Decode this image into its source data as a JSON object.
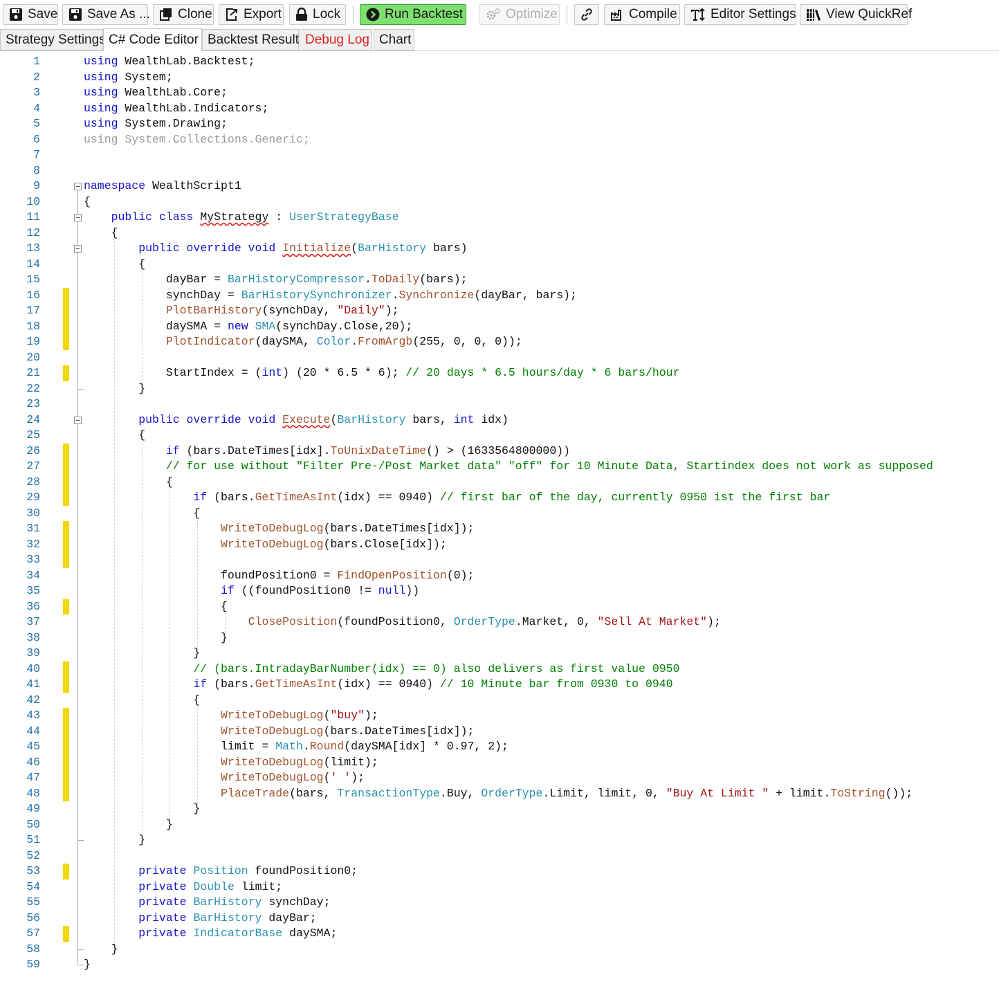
{
  "toolbar": {
    "save": "Save",
    "save_as": "Save As ...",
    "clone": "Clone",
    "export": "Export",
    "lock": "Lock",
    "run_backtest": "Run Backtest",
    "optimize": "Optimize",
    "compile": "Compile",
    "editor_settings": "Editor Settings",
    "view_quickref": "View QuickRef"
  },
  "tabs": [
    "Strategy Settings",
    "C# Code Editor",
    "Backtest Results",
    "Debug Log",
    "Chart"
  ],
  "active_tab": "C# Code Editor",
  "colors": {
    "keyword": "#1414c8",
    "type": "#2b91af",
    "method": "#a0522d",
    "string": "#a31515",
    "comment": "#008000",
    "line_number": "#1e6fa8",
    "change_marker": "#f2d700",
    "run_button": "#7ee06f",
    "debug_tab_text": "#e02020"
  },
  "icons": {
    "save": "floppy-disk-icon",
    "save_as": "floppy-disk-icon",
    "clone": "copy-icon",
    "export": "export-icon",
    "lock": "padlock-icon",
    "run_backtest": "play-circle-icon",
    "optimize": "gears-icon",
    "link": "link-icon",
    "compile": "compile-icon",
    "editor_settings": "text-size-icon",
    "view_quickref": "books-icon"
  },
  "editor": {
    "lines": [
      {
        "n": "1",
        "t": [
          [
            "kw",
            "using"
          ],
          [
            "pl",
            " WealthLab.Backtest;"
          ]
        ]
      },
      {
        "n": "2",
        "t": [
          [
            "kw",
            "using"
          ],
          [
            "pl",
            " System;"
          ]
        ]
      },
      {
        "n": "3",
        "t": [
          [
            "kw",
            "using"
          ],
          [
            "pl",
            " WealthLab.Core;"
          ]
        ]
      },
      {
        "n": "4",
        "t": [
          [
            "kw",
            "using"
          ],
          [
            "pl",
            " WealthLab.Indicators;"
          ]
        ]
      },
      {
        "n": "5",
        "t": [
          [
            "kw",
            "using"
          ],
          [
            "pl",
            " System.Drawing;"
          ]
        ]
      },
      {
        "n": "6",
        "t": [
          [
            "dim",
            "using System.Collections.Generic;"
          ]
        ]
      },
      {
        "n": "7",
        "t": []
      },
      {
        "n": "8",
        "t": []
      },
      {
        "n": "9",
        "t": [
          [
            "kw",
            "namespace"
          ],
          [
            "pl",
            " WealthScript1"
          ]
        ]
      },
      {
        "n": "10",
        "t": [
          [
            "pl",
            "{"
          ]
        ]
      },
      {
        "n": "11",
        "t": [
          [
            "pl",
            "    "
          ],
          [
            "kw",
            "public class"
          ],
          [
            "pl",
            " "
          ],
          [
            "sq",
            "MyStrategy"
          ],
          [
            "pl",
            " : "
          ],
          [
            "ty",
            "UserStrategyBase"
          ]
        ]
      },
      {
        "n": "12",
        "t": [
          [
            "pl",
            "    {"
          ]
        ]
      },
      {
        "n": "13",
        "t": [
          [
            "pl",
            "        "
          ],
          [
            "kw",
            "public override void"
          ],
          [
            "pl",
            " "
          ],
          [
            "sqfn",
            "Initialize"
          ],
          [
            "pl",
            "("
          ],
          [
            "ty",
            "BarHistory"
          ],
          [
            "pl",
            " bars)"
          ]
        ]
      },
      {
        "n": "14",
        "t": [
          [
            "pl",
            "        {"
          ]
        ]
      },
      {
        "n": "15",
        "t": [
          [
            "pl",
            "            dayBar = "
          ],
          [
            "ty",
            "BarHistoryCompressor"
          ],
          [
            "pl",
            "."
          ],
          [
            "fn",
            "ToDaily"
          ],
          [
            "pl",
            "(bars);"
          ]
        ]
      },
      {
        "n": "16",
        "t": [
          [
            "pl",
            "            synchDay = "
          ],
          [
            "ty",
            "BarHistorySynchronizer"
          ],
          [
            "pl",
            "."
          ],
          [
            "fn",
            "Synchronize"
          ],
          [
            "pl",
            "(dayBar, bars);"
          ]
        ]
      },
      {
        "n": "17",
        "t": [
          [
            "pl",
            "            "
          ],
          [
            "fn",
            "PlotBarHistory"
          ],
          [
            "pl",
            "(synchDay, "
          ],
          [
            "str",
            "\"Daily\""
          ],
          [
            "pl",
            ");"
          ]
        ]
      },
      {
        "n": "18",
        "t": [
          [
            "pl",
            "            daySMA = "
          ],
          [
            "kw",
            "new"
          ],
          [
            "pl",
            " "
          ],
          [
            "ty",
            "SMA"
          ],
          [
            "pl",
            "(synchDay.Close,20);"
          ]
        ]
      },
      {
        "n": "19",
        "t": [
          [
            "pl",
            "            "
          ],
          [
            "fn",
            "PlotIndicator"
          ],
          [
            "pl",
            "(daySMA, "
          ],
          [
            "ty",
            "Color"
          ],
          [
            "pl",
            "."
          ],
          [
            "fn",
            "FromArgb"
          ],
          [
            "pl",
            "(255, 0, 0, 0));"
          ]
        ]
      },
      {
        "n": "20",
        "t": []
      },
      {
        "n": "21",
        "t": [
          [
            "pl",
            "            StartIndex = ("
          ],
          [
            "kw",
            "int"
          ],
          [
            "pl",
            ") (20 * 6.5 * 6); "
          ],
          [
            "cm",
            "// 20 days * 6.5 hours/day * 6 bars/hour"
          ]
        ]
      },
      {
        "n": "22",
        "t": [
          [
            "pl",
            "        }"
          ]
        ]
      },
      {
        "n": "23",
        "t": []
      },
      {
        "n": "24",
        "t": [
          [
            "pl",
            "        "
          ],
          [
            "kw",
            "public override void"
          ],
          [
            "pl",
            " "
          ],
          [
            "sqfn",
            "Execute"
          ],
          [
            "pl",
            "("
          ],
          [
            "ty",
            "BarHistory"
          ],
          [
            "pl",
            " bars, "
          ],
          [
            "kw",
            "int"
          ],
          [
            "pl",
            " idx)"
          ]
        ]
      },
      {
        "n": "25",
        "t": [
          [
            "pl",
            "        {"
          ]
        ]
      },
      {
        "n": "26",
        "t": [
          [
            "pl",
            "            "
          ],
          [
            "kw",
            "if"
          ],
          [
            "pl",
            " (bars.DateTimes[idx]."
          ],
          [
            "fn",
            "ToUnixDateTime"
          ],
          [
            "pl",
            "() > (1633564800000))"
          ]
        ]
      },
      {
        "n": "27",
        "t": [
          [
            "pl",
            "            "
          ],
          [
            "cm",
            "// for use without \"Filter Pre-/Post Market data\" \"off\" for 10 Minute Data, Startindex does not work as supposed"
          ]
        ]
      },
      {
        "n": "28",
        "t": [
          [
            "pl",
            "            {"
          ]
        ]
      },
      {
        "n": "29",
        "t": [
          [
            "pl",
            "                "
          ],
          [
            "kw",
            "if"
          ],
          [
            "pl",
            " (bars."
          ],
          [
            "fn",
            "GetTimeAsInt"
          ],
          [
            "pl",
            "(idx) == 0940) "
          ],
          [
            "cm",
            "// first bar of the day, currently 0950 ist the first bar"
          ]
        ]
      },
      {
        "n": "30",
        "t": [
          [
            "pl",
            "                {"
          ]
        ]
      },
      {
        "n": "31",
        "t": [
          [
            "pl",
            "                    "
          ],
          [
            "fn",
            "WriteToDebugLog"
          ],
          [
            "pl",
            "(bars.DateTimes[idx]);"
          ]
        ]
      },
      {
        "n": "32",
        "t": [
          [
            "pl",
            "                    "
          ],
          [
            "fn",
            "WriteToDebugLog"
          ],
          [
            "pl",
            "(bars.Close[idx]);"
          ]
        ]
      },
      {
        "n": "33",
        "t": []
      },
      {
        "n": "34",
        "t": [
          [
            "pl",
            "                    foundPosition0 = "
          ],
          [
            "fn",
            "FindOpenPosition"
          ],
          [
            "pl",
            "(0);"
          ]
        ]
      },
      {
        "n": "35",
        "t": [
          [
            "pl",
            "                    "
          ],
          [
            "kw",
            "if"
          ],
          [
            "pl",
            " ((foundPosition0 != "
          ],
          [
            "kw",
            "null"
          ],
          [
            "pl",
            "))"
          ]
        ]
      },
      {
        "n": "36",
        "t": [
          [
            "pl",
            "                    {"
          ]
        ]
      },
      {
        "n": "37",
        "t": [
          [
            "pl",
            "                        "
          ],
          [
            "fn",
            "ClosePosition"
          ],
          [
            "pl",
            "(foundPosition0, "
          ],
          [
            "ty",
            "OrderType"
          ],
          [
            "pl",
            ".Market, 0, "
          ],
          [
            "str",
            "\"Sell At Market\""
          ],
          [
            "pl",
            ");"
          ]
        ]
      },
      {
        "n": "38",
        "t": [
          [
            "pl",
            "                    }"
          ]
        ]
      },
      {
        "n": "39",
        "t": [
          [
            "pl",
            "                }"
          ]
        ]
      },
      {
        "n": "40",
        "t": [
          [
            "pl",
            "                "
          ],
          [
            "cm",
            "// (bars.IntradayBarNumber(idx) == 0) also delivers as first value 0950"
          ]
        ]
      },
      {
        "n": "41",
        "t": [
          [
            "pl",
            "                "
          ],
          [
            "kw",
            "if"
          ],
          [
            "pl",
            " (bars."
          ],
          [
            "fn",
            "GetTimeAsInt"
          ],
          [
            "pl",
            "(idx) == 0940) "
          ],
          [
            "cm",
            "// 10 Minute bar from 0930 to 0940"
          ]
        ]
      },
      {
        "n": "42",
        "t": [
          [
            "pl",
            "                {"
          ]
        ]
      },
      {
        "n": "43",
        "t": [
          [
            "pl",
            "                    "
          ],
          [
            "fn",
            "WriteToDebugLog"
          ],
          [
            "pl",
            "("
          ],
          [
            "str",
            "\"buy\""
          ],
          [
            "pl",
            ");"
          ]
        ]
      },
      {
        "n": "44",
        "t": [
          [
            "pl",
            "                    "
          ],
          [
            "fn",
            "WriteToDebugLog"
          ],
          [
            "pl",
            "(bars.DateTimes[idx]);"
          ]
        ]
      },
      {
        "n": "45",
        "t": [
          [
            "pl",
            "                    limit = "
          ],
          [
            "ty",
            "Math"
          ],
          [
            "pl",
            "."
          ],
          [
            "fn",
            "Round"
          ],
          [
            "pl",
            "(daySMA[idx] * 0.97, 2);"
          ]
        ]
      },
      {
        "n": "46",
        "t": [
          [
            "pl",
            "                    "
          ],
          [
            "fn",
            "WriteToDebugLog"
          ],
          [
            "pl",
            "(limit);"
          ]
        ]
      },
      {
        "n": "47",
        "t": [
          [
            "pl",
            "                    "
          ],
          [
            "fn",
            "WriteToDebugLog"
          ],
          [
            "pl",
            "("
          ],
          [
            "str",
            "' '"
          ],
          [
            "pl",
            ");"
          ]
        ]
      },
      {
        "n": "48",
        "t": [
          [
            "pl",
            "                    "
          ],
          [
            "fn",
            "PlaceTrade"
          ],
          [
            "pl",
            "(bars, "
          ],
          [
            "ty",
            "TransactionType"
          ],
          [
            "pl",
            ".Buy, "
          ],
          [
            "ty",
            "OrderType"
          ],
          [
            "pl",
            ".Limit, limit, 0, "
          ],
          [
            "str",
            "\"Buy At Limit \""
          ],
          [
            "pl",
            " + limit."
          ],
          [
            "fn",
            "ToString"
          ],
          [
            "pl",
            "());"
          ]
        ]
      },
      {
        "n": "49",
        "t": [
          [
            "pl",
            "                }"
          ]
        ]
      },
      {
        "n": "50",
        "t": [
          [
            "pl",
            "            }"
          ]
        ]
      },
      {
        "n": "51",
        "t": [
          [
            "pl",
            "        }"
          ]
        ]
      },
      {
        "n": "52",
        "t": []
      },
      {
        "n": "53",
        "t": [
          [
            "pl",
            "        "
          ],
          [
            "kw",
            "private"
          ],
          [
            "pl",
            " "
          ],
          [
            "ty",
            "Position"
          ],
          [
            "pl",
            " foundPosition0;"
          ]
        ]
      },
      {
        "n": "54",
        "t": [
          [
            "pl",
            "        "
          ],
          [
            "kw",
            "private"
          ],
          [
            "pl",
            " "
          ],
          [
            "ty",
            "Double"
          ],
          [
            "pl",
            " limit;"
          ]
        ]
      },
      {
        "n": "55",
        "t": [
          [
            "pl",
            "        "
          ],
          [
            "kw",
            "private"
          ],
          [
            "pl",
            " "
          ],
          [
            "ty",
            "BarHistory"
          ],
          [
            "pl",
            " synchDay;"
          ]
        ]
      },
      {
        "n": "56",
        "t": [
          [
            "pl",
            "        "
          ],
          [
            "kw",
            "private"
          ],
          [
            "pl",
            " "
          ],
          [
            "ty",
            "BarHistory"
          ],
          [
            "pl",
            " dayBar;"
          ]
        ]
      },
      {
        "n": "57",
        "t": [
          [
            "pl",
            "        "
          ],
          [
            "kw",
            "private"
          ],
          [
            "pl",
            " "
          ],
          [
            "ty",
            "IndicatorBase"
          ],
          [
            "pl",
            " daySMA;"
          ]
        ]
      },
      {
        "n": "58",
        "t": [
          [
            "pl",
            "    }"
          ]
        ]
      },
      {
        "n": "59",
        "t": [
          [
            "pl",
            "}"
          ]
        ]
      }
    ],
    "modified_lines": [
      "16",
      "17",
      "18",
      "19",
      "21",
      "26",
      "27",
      "28",
      "29",
      "31",
      "32",
      "33",
      "36",
      "40",
      "41",
      "43",
      "44",
      "45",
      "46",
      "47",
      "48",
      "53",
      "57"
    ]
  }
}
